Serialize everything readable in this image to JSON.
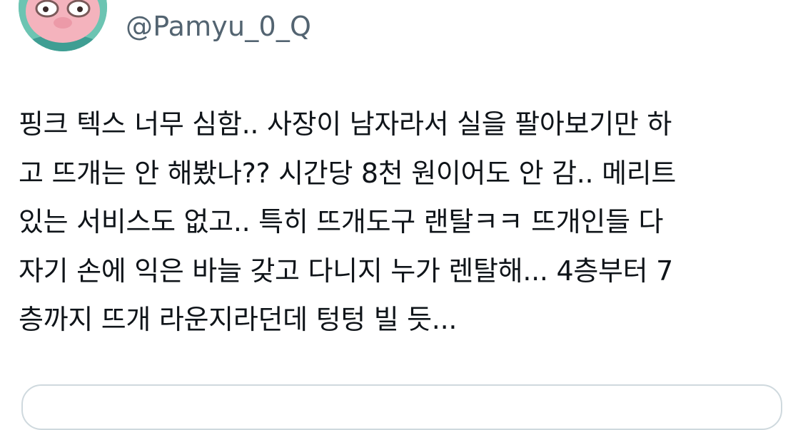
{
  "author": {
    "display_name": "",
    "handle": "@Pamyu_0_Q",
    "avatar_icon": "cartoon-pig-avatar"
  },
  "watermark": {
    "text": ""
  },
  "tweet": {
    "lines": [
      "핑크 텍스 너무 심함.. 사장이 남자라서 실을 팔아보기만 하",
      "고 뜨개는 안 해봤나?? 시간당 8천 원이어도 안 감.. 메리트",
      "있는 서비스도 없고.. 특히 뜨개도구 랜탈ㅋㅋ 뜨개인들 다",
      "자기 손에 익은 바늘 갖고 다니지 누가 렌탈해... 4층부터 7",
      "층까지 뜨개 라운지라던데 텅텅 빌 듯..."
    ]
  },
  "colors": {
    "text_primary": "#0f1419",
    "text_secondary": "#536471",
    "border": "#cfd9de",
    "avatar_bg": "#6cc4b2",
    "avatar_face": "#f4b3bd",
    "avatar_hat": "#e0443e"
  }
}
